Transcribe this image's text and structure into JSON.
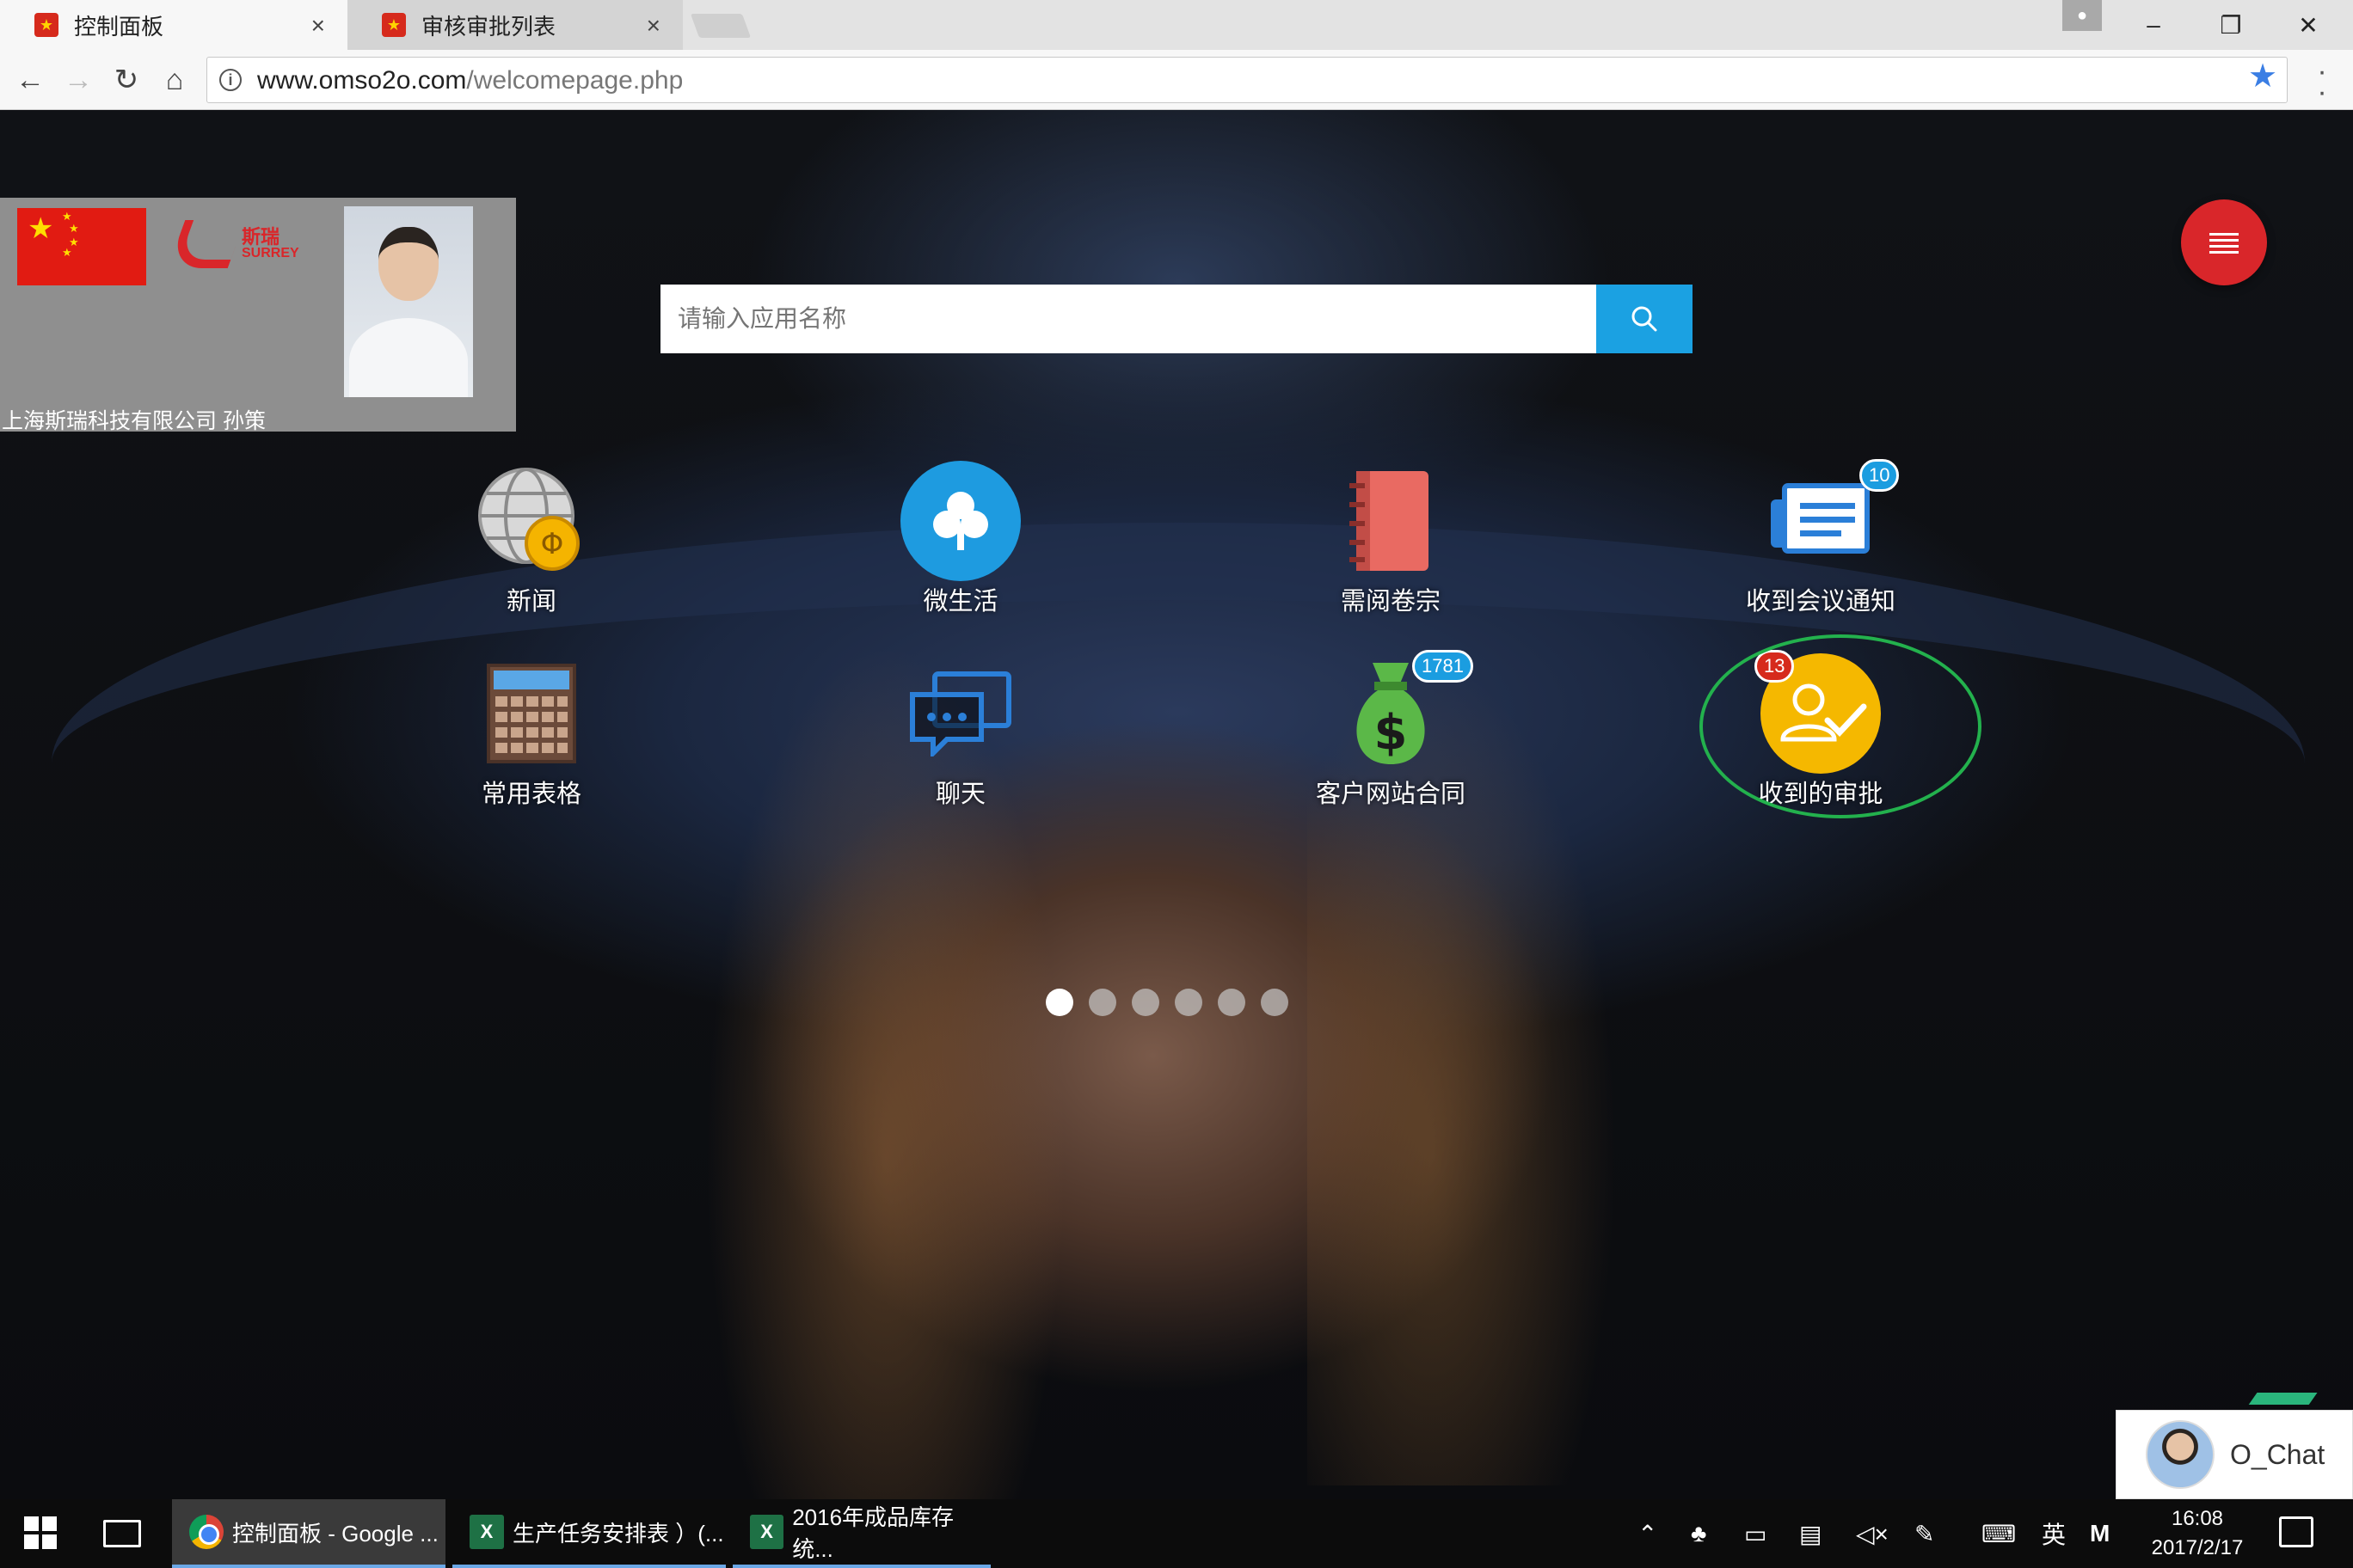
{
  "browser": {
    "tabs": [
      {
        "label": "控制面板",
        "active": true
      },
      {
        "label": "审核审批列表",
        "active": false
      }
    ],
    "url_host": "www.omso2o.com",
    "url_path": "/welcomepage.php"
  },
  "profile": {
    "caption": "上海斯瑞科技有限公司 孙策",
    "logo_cn": "斯瑞",
    "logo_en": "SURREY"
  },
  "search": {
    "placeholder": "请输入应用名称"
  },
  "apps": [
    {
      "label": "新闻",
      "icon": "globe-coin-icon"
    },
    {
      "label": "微生活",
      "icon": "clover-icon"
    },
    {
      "label": "需阅卷宗",
      "icon": "notebook-icon"
    },
    {
      "label": "收到会议通知",
      "icon": "notice-icon",
      "badge": "10"
    },
    {
      "label": "常用表格",
      "icon": "calculator-icon"
    },
    {
      "label": "聊天",
      "icon": "chat-bubbles-icon"
    },
    {
      "label": "客户网站合同",
      "icon": "money-bag-icon",
      "badge": "1781"
    },
    {
      "label": "收到的审批",
      "icon": "approval-icon",
      "badge": "13"
    }
  ],
  "pager": {
    "count": 6,
    "active_index": 0
  },
  "chat_widget": {
    "label": "O_Chat"
  },
  "taskbar": {
    "items": [
      {
        "label": "控制面板 - Google ...",
        "icon": "chrome-icon"
      },
      {
        "label": "生产任务安排表 ）(...",
        "icon": "excel-icon"
      },
      {
        "label": "2016年成品库存统...",
        "icon": "excel-icon"
      }
    ],
    "ime": "英",
    "ime2": "M",
    "time": "16:08",
    "date": "2017/2/17"
  },
  "colors": {
    "accent_blue": "#1ba1e2",
    "fab_red": "#d9262a",
    "highlight_green": "#23b14d"
  }
}
